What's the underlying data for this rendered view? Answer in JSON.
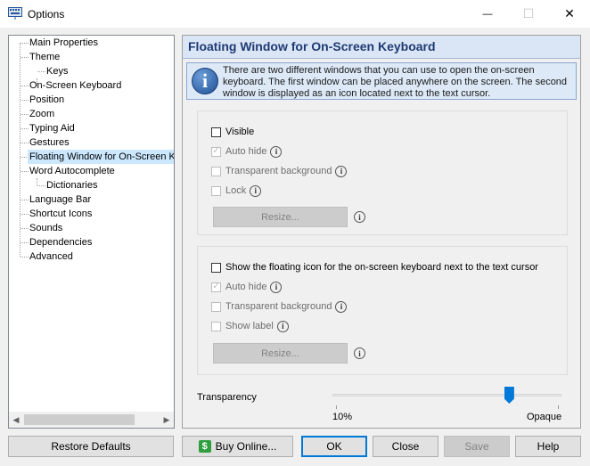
{
  "window": {
    "title": "Options",
    "minimize_glyph": "—",
    "maximize_glyph": "☐",
    "close_glyph": "✕"
  },
  "tree": {
    "items": [
      {
        "label": "Main Properties"
      },
      {
        "label": "Theme"
      },
      {
        "label": "Keys"
      },
      {
        "label": "On-Screen Keyboard"
      },
      {
        "label": "Position"
      },
      {
        "label": "Zoom"
      },
      {
        "label": "Typing Aid"
      },
      {
        "label": "Gestures"
      },
      {
        "label": "Floating Window for On-Screen Ke",
        "selected": true
      },
      {
        "label": "Word Autocomplete"
      },
      {
        "label": "Dictionaries"
      },
      {
        "label": "Language Bar"
      },
      {
        "label": "Shortcut Icons"
      },
      {
        "label": "Sounds"
      },
      {
        "label": "Dependencies"
      },
      {
        "label": "Advanced"
      }
    ],
    "scroll_left_glyph": "◀",
    "scroll_right_glyph": "▶"
  },
  "panel": {
    "heading": "Floating Window for On-Screen Keyboard",
    "info_icon_glyph": "i",
    "info_text": "There are two different windows that you can use to open the on-screen keyboard. The first window can be placed anywhere on the screen. The second window is displayed as an icon located next to the text cursor.",
    "group1": {
      "visible_label": "Visible",
      "visible_checked": false,
      "auto_hide_label": "Auto hide",
      "auto_hide_checked": true,
      "transparent_label": "Transparent background",
      "transparent_checked": false,
      "lock_label": "Lock",
      "lock_checked": false,
      "resize_label": "Resize..."
    },
    "group2": {
      "show_icon_label": "Show the floating icon for the on-screen keyboard next to the text cursor",
      "show_icon_checked": false,
      "auto_hide_label": "Auto hide",
      "auto_hide_checked": true,
      "transparent_label": "Transparent background",
      "transparent_checked": false,
      "show_label_label": "Show label",
      "show_label_checked": false,
      "resize_label": "Resize..."
    },
    "info_glyph": "i",
    "check_glyph": "✓",
    "transparency": {
      "label": "Transparency",
      "min_label": "10%",
      "max_label": "Opaque",
      "value_fraction": 0.77
    }
  },
  "buttons": {
    "restore": "Restore Defaults",
    "buy": "Buy Online...",
    "buy_icon_glyph": "$",
    "ok": "OK",
    "close": "Close",
    "save": "Save",
    "help": "Help"
  },
  "colors": {
    "header_bg": "#dae6f5",
    "heading_text": "#1f3b73",
    "selection": "#cce8ff",
    "accent": "#0078d7"
  }
}
